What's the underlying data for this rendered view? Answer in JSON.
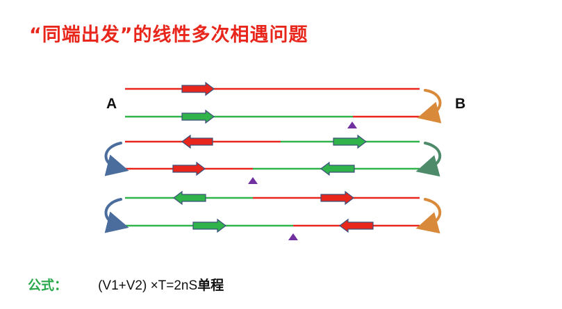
{
  "title": "“同端出发”的线性多次相遇问题",
  "labels": {
    "a": "A",
    "b": "B"
  },
  "formula": {
    "label": "公式：",
    "text": "(V1+V2)  ×T=2nS",
    "unit": "单程"
  },
  "colors": {
    "red": "#e8261c",
    "green": "#2fb34a",
    "meet": "#7030a0",
    "curve": "#8f8f8f"
  },
  "icons": [
    "right-arrow-icon",
    "left-arrow-icon",
    "meeting-point-icon",
    "u-turn-arrow-icon"
  ]
}
